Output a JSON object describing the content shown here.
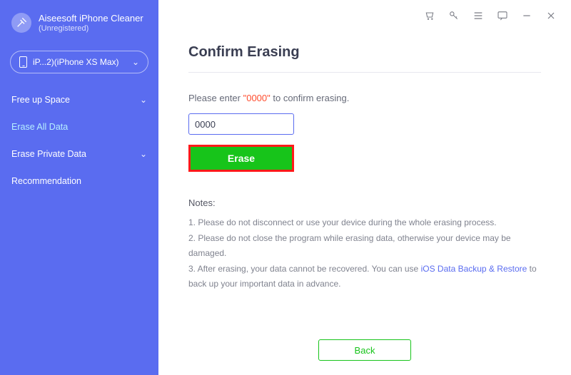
{
  "brand": {
    "title": "Aiseesoft iPhone Cleaner",
    "sub": "(Unregistered)"
  },
  "device": {
    "label": "iP...2)(iPhone XS Max)"
  },
  "nav": {
    "freeup": "Free up Space",
    "eraseAll": "Erase All Data",
    "erasePrivate": "Erase Private Data",
    "recommendation": "Recommendation"
  },
  "main": {
    "title": "Confirm Erasing",
    "prompt_pre": "Please enter ",
    "prompt_code": "\"0000\"",
    "prompt_post": " to confirm erasing.",
    "input_value": "0000",
    "erase_label": "Erase",
    "notes_title": "Notes:",
    "note1": "1. Please do not disconnect or use your device during the whole erasing process.",
    "note2": "2. Please do not close the program while erasing data, otherwise your device may be damaged.",
    "note3_pre": "3. After erasing, your data cannot be recovered. You can use ",
    "note3_link": "iOS Data Backup & Restore",
    "note3_post": " to back up your important data in advance.",
    "back_label": "Back"
  }
}
